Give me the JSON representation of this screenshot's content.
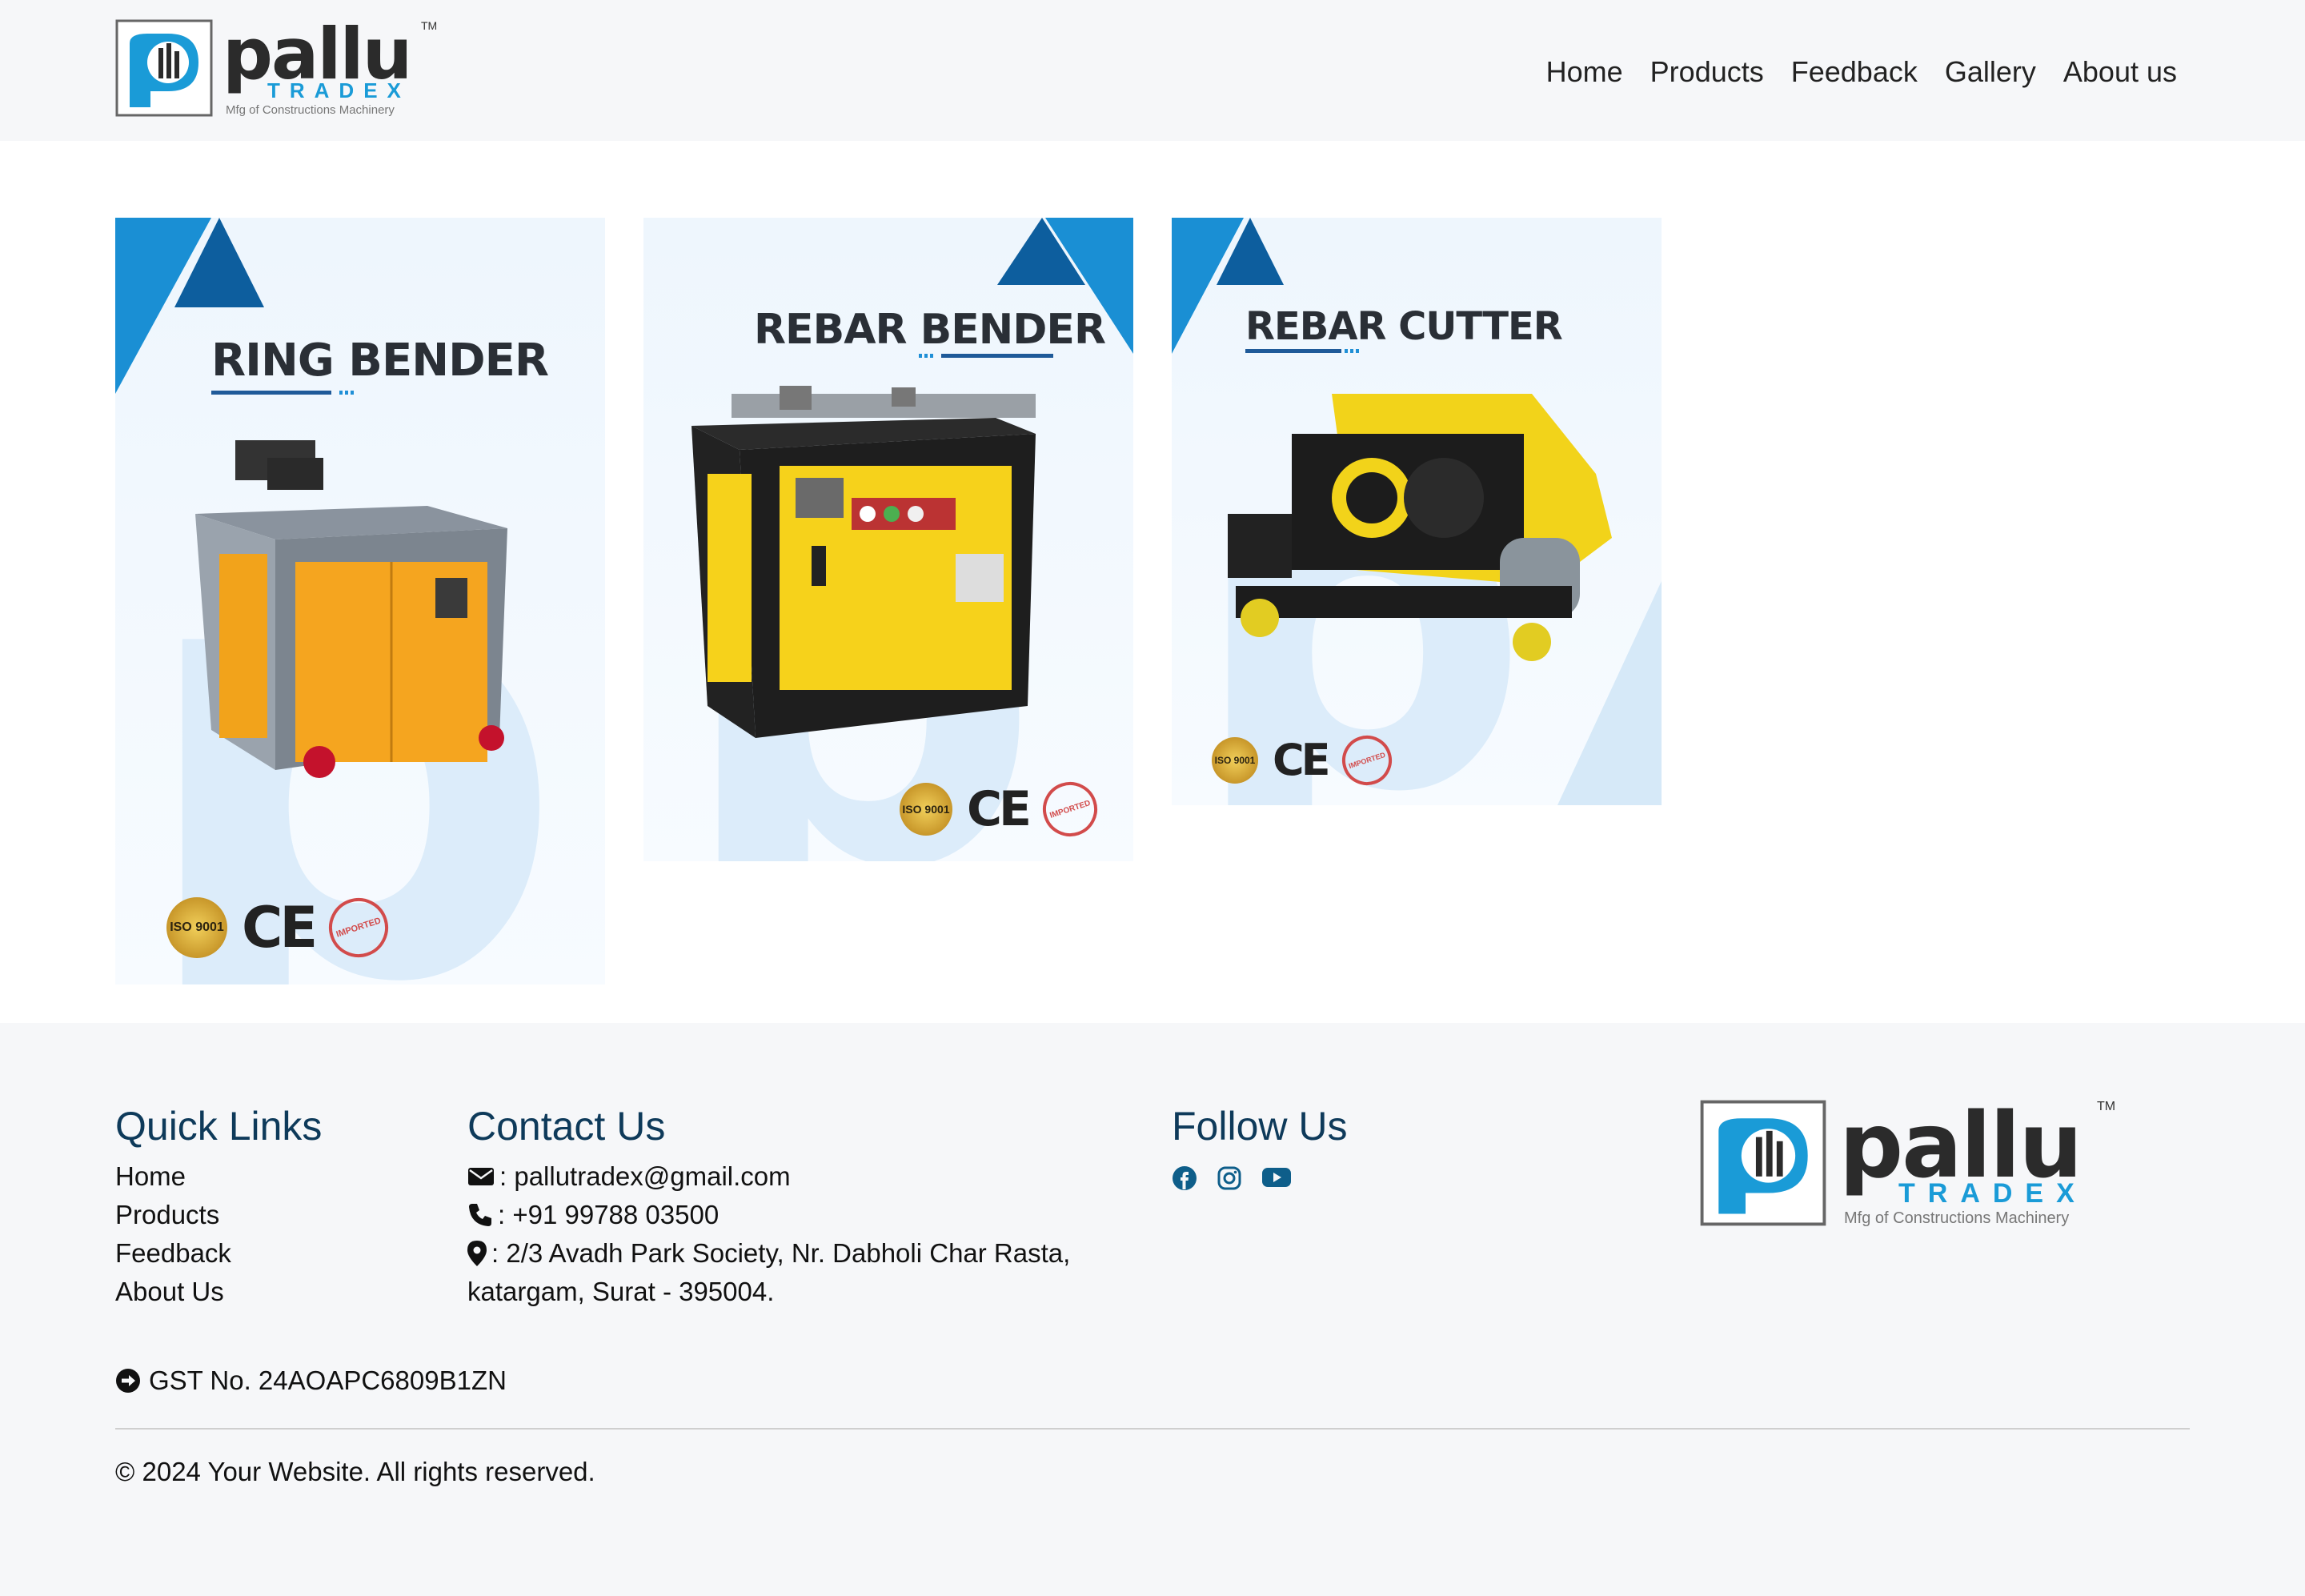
{
  "brand": {
    "name": "pallu",
    "tm": "TM",
    "sub": "TRADEX",
    "tagline": "Mfg of Constructions Machinery",
    "accent": "#1a9bd7"
  },
  "nav": {
    "items": [
      "Home",
      "Products",
      "Feedback",
      "Gallery",
      "About us"
    ]
  },
  "products": [
    {
      "title": "RING BENDER",
      "badges": {
        "iso": "ISO 9001",
        "ce": "CE",
        "imported": "IMPORTED"
      }
    },
    {
      "title": "REBAR BENDER",
      "badges": {
        "iso": "ISO 9001",
        "ce": "CE",
        "imported": "IMPORTED"
      }
    },
    {
      "title": "REBAR CUTTER",
      "badges": {
        "iso": "ISO 9001",
        "ce": "CE",
        "imported": "IMPORTED"
      }
    }
  ],
  "footer": {
    "quick_links": {
      "heading": "Quick Links",
      "items": [
        "Home",
        "Products",
        "Feedback",
        "About Us"
      ]
    },
    "contact": {
      "heading": "Contact Us",
      "email": ": pallutradex@gmail.com",
      "phone": ": +91 99788 03500",
      "address_line1": ": 2/3 Avadh Park Society, Nr. Dabholi Char Rasta,",
      "address_line2": "katargam, Surat - 395004."
    },
    "follow": {
      "heading": "Follow Us",
      "icons": [
        "facebook-icon",
        "instagram-icon",
        "youtube-icon"
      ]
    },
    "gst": "GST No. 24AOAPC6809B1ZN",
    "copyright": "© 2024 Your Website. All rights reserved."
  }
}
